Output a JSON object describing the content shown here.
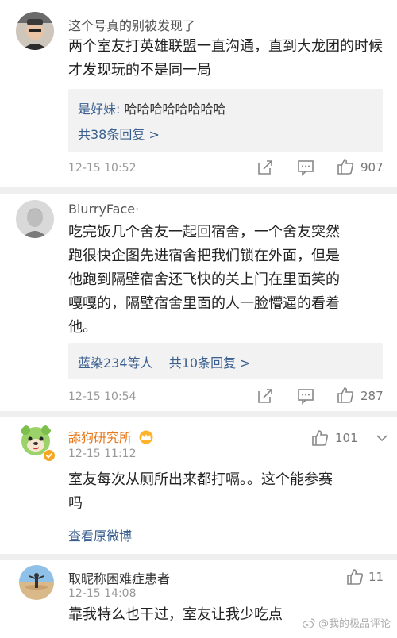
{
  "comments": [
    {
      "username": "这个号真的别被发现了",
      "text": "两个室友打英雄联盟一直沟通，直到大龙团的时候才发现玩的不是同一局",
      "reply_author": "是好妹:",
      "reply_text": "哈哈哈哈哈哈哈哈",
      "reply_count_label": "共38条回复 >",
      "time": "12-15 10:52",
      "likes": "907"
    },
    {
      "username": "BlurryFace·",
      "text_lines": [
        "吃完饭几个舍友一起回宿舍，一个舍友突然",
        "跑很快企图先进宿舍把我们锁在外面，但是",
        "他跑到隔壁宿舍还飞快的关上门在里面笑的",
        "嘎嘎的，隔壁宿舍里面的人一脸懵逼的看着",
        "他。"
      ],
      "liked_by": "蓝染234等人",
      "reply_count_label": "共10条回复 >",
      "time": "12-15 10:54",
      "likes": "287"
    },
    {
      "username": "舔狗研究所",
      "time": "12-15 11:12",
      "likes": "101",
      "text_lines": [
        "室友每次从厕所出来都打嗝。。这个能参赛",
        "吗"
      ],
      "view_original": "查看原微博"
    },
    {
      "username": "取昵称困难症患者",
      "time": "12-15 14:08",
      "likes": "11",
      "text": "靠我特么也干过，室友让我少吃点"
    }
  ],
  "watermark": "@我的极品评论",
  "colors": {
    "link_blue": "#3a5f8f",
    "separator": "#efefef",
    "username_orange": "#e8761a"
  }
}
